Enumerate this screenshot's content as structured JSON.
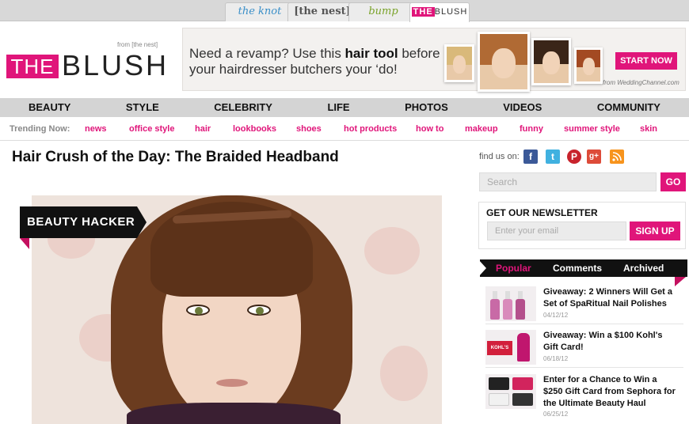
{
  "site_tabs": [
    {
      "label": "the knot"
    },
    {
      "label": "[the nest]"
    },
    {
      "label": "bump"
    },
    {
      "label_prefix": "THE",
      "label": "BLUSH"
    }
  ],
  "logo": {
    "from": "from [the nest]",
    "the": "THE",
    "blush": "BLUSH"
  },
  "ad": {
    "text_pre": "Need a revamp? Use this ",
    "text_bold": "hair tool",
    "text_post": " before your hairdresser butchers your ‘do!",
    "button": "START NOW",
    "footer": "from WeddingChannel.com"
  },
  "nav": [
    "BEAUTY",
    "STYLE",
    "CELEBRITY",
    "LIFE",
    "PHOTOS",
    "VIDEOS",
    "COMMUNITY"
  ],
  "trending": {
    "label": "Trending Now:",
    "links": [
      "news",
      "office style",
      "hair",
      "lookbooks",
      "shoes",
      "hot products",
      "how to",
      "makeup",
      "funny",
      "summer style",
      "skin"
    ]
  },
  "article": {
    "title": "Hair Crush of the Day: The Braided Headband",
    "badge": "BEAUTY HACKER"
  },
  "sidebar": {
    "find_us": "find us on:",
    "social": {
      "facebook": "f",
      "twitter": "t",
      "pinterest": "P",
      "googleplus": "g+",
      "rss": "rss"
    },
    "search_placeholder": "Search",
    "go": "GO",
    "newsletter": {
      "heading": "GET OUR NEWSLETTER",
      "placeholder": "Enter your email",
      "button": "SIGN UP"
    },
    "tabs": [
      "Popular",
      "Comments",
      "Archived"
    ],
    "items": [
      {
        "title": "Giveaway: 2 Winners Will Get a Set of SpaRitual Nail Polishes",
        "date": "04/12/12"
      },
      {
        "title": "Giveaway: Win a $100 Kohl's Gift Card!",
        "date": "06/18/12"
      },
      {
        "title": "Enter for a Chance to Win a $250 Gift Card from Sephora for the Ultimate Beauty Haul",
        "date": "06/25/12"
      }
    ],
    "thumb_text": {
      "kohls": "KOHL'S"
    }
  },
  "colors": {
    "accent": "#e0157a",
    "nav_bg": "#d4d4d4",
    "dark": "#111111"
  }
}
